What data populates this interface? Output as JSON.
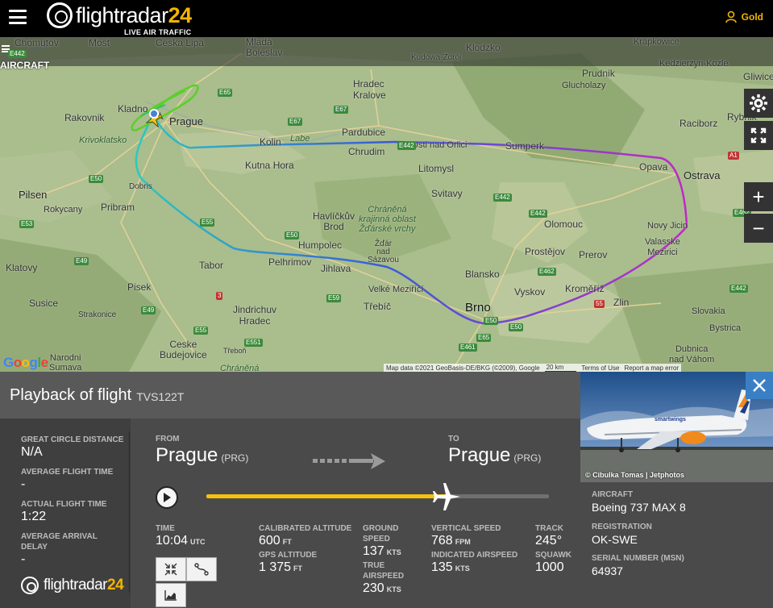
{
  "header": {
    "logo_main": "flightradar",
    "logo_num": "24",
    "logo_sub": "LIVE AIR TRAFFIC",
    "user_label": "Gold"
  },
  "map": {
    "tab_label": "AIRCRAFT",
    "labels": {
      "chomutov": "Chomutov",
      "most": "Most",
      "ceska_lipa": "Ceska Lipa",
      "mlada_boleslav": "Mlada\nBoleslav",
      "kudowa": "Kudowa-Zdrój",
      "klodzko": "Klodzko",
      "krapkowice": "Krapkowice",
      "hradec": "Hradec\nKralove",
      "prudnik": "Prudnik",
      "glucholazy": "Glucholazy",
      "kedzierzyn": "Kedzierzyn-Kozle",
      "gliwice": "Gliwice",
      "kladno": "Kladno",
      "rakovnik": "Rakovnik",
      "prague": "Prague",
      "krivoklatsko": "Krivoklatsko",
      "kolin": "Kolin",
      "labe": "Labe",
      "pardubice": "Pardubice",
      "chrudim": "Chrudim",
      "usti": "Usti nad Orlici",
      "sumperk": "Sumperk",
      "opava": "Opava",
      "raciborz": "Raciborz",
      "rybnik": "Rybnik",
      "ostrava": "Ostrava",
      "kutna": "Kutna Hora",
      "litomysl": "Litomysl",
      "svitavy": "Svitavy",
      "pilsen": "Pilsen",
      "rokycany": "Rokycany",
      "pribram": "Pribram",
      "dobris": "Dobris",
      "havlickuv": "Havlíčkův\nBrod",
      "chranena1": "Chráněná\nkrajinná oblast\nŽďárské vrchy",
      "olomouc": "Olomouc",
      "novy_jicin": "Novy Jicin",
      "valasske": "Valasske\nMezirici",
      "humpolec": "Humpolec",
      "zdar": "Žďár\nnad\nSázavou",
      "prostejov": "Prostějov",
      "prerov": "Prerov",
      "klatovy": "Klatovy",
      "tabor": "Tabor",
      "pelhrimov": "Pelhrimov",
      "jihlava": "Jihlava",
      "blansko": "Blansko",
      "vyskov": "Vyskov",
      "kromeriz": "Kroměříž",
      "zlin": "Zlin",
      "velke": "Velké Meziříčí",
      "trebic": "Třebíč",
      "brno": "Brno",
      "pisek": "Pisek",
      "susice": "Susice",
      "jindrichuv": "Jindrichuv\nHradec",
      "strakonice": "Strakonice",
      "ceske": "Ceske\nBudejovice",
      "trebon": "Třeboň",
      "narodni": "Narodni\nSumava",
      "chranena2": "Chráněná",
      "dubnica": "Dubnica\nnad Váhom",
      "bystrica": "Bystrica",
      "slovakia": "Slovakia"
    },
    "attribution": "Map data ©2021 GeoBasis-DE/BKG (©2009), Google",
    "scale": "20 km",
    "terms": "Terms of Use",
    "report": "Report a map error",
    "google": "Google"
  },
  "playback": {
    "title": "Playback of flight",
    "callsign": "TVS122T",
    "great_circle_label": "GREAT CIRCLE DISTANCE",
    "great_circle_value": "N/A",
    "avg_flight_label": "AVERAGE FLIGHT TIME",
    "avg_flight_value": "-",
    "actual_flight_label": "ACTUAL FLIGHT TIME",
    "actual_flight_value": "1:22",
    "avg_arrival_label": "AVERAGE ARRIVAL DELAY",
    "avg_arrival_value": "-",
    "from_label": "FROM",
    "from_city": "Prague",
    "from_code": "(PRG)",
    "to_label": "TO",
    "to_city": "Prague",
    "to_code": "(PRG)",
    "progress": 0.7,
    "time_label": "TIME",
    "time_value": "10:04",
    "time_unit": "UTC",
    "cal_alt_label": "CALIBRATED ALTITUDE",
    "cal_alt_value": "600",
    "cal_alt_unit": "FT",
    "gps_alt_label": "GPS ALTITUDE",
    "gps_alt_value": "1 375",
    "gps_alt_unit": "FT",
    "gs_label": "GROUND SPEED",
    "gs_value": "137",
    "gs_unit": "KTS",
    "tas_label": "TRUE AIRSPEED",
    "tas_value": "230",
    "tas_unit": "KTS",
    "vs_label": "VERTICAL SPEED",
    "vs_value": "768",
    "vs_unit": "FPM",
    "ias_label": "INDICATED AIRSPEED",
    "ias_value": "135",
    "ias_unit": "KTS",
    "track_label": "TRACK",
    "track_value": "245°",
    "squawk_label": "SQUAWK",
    "squawk_value": "1000",
    "footer_logo": "flightradar",
    "footer_logo_num": "24"
  },
  "aircraft": {
    "photo_credit": "© Cibulka Tomas | Jetphotos",
    "aircraft_label": "AIRCRAFT",
    "aircraft_value": "Boeing 737 MAX 8",
    "registration_label": "REGISTRATION",
    "registration_value": "OK-SWE",
    "serial_label": "SERIAL NUMBER (MSN)",
    "serial_value": "64937"
  },
  "colors": {
    "accent": "#f4b400",
    "close_button": "#3a7fc4",
    "panel": "#4a4a4a"
  }
}
